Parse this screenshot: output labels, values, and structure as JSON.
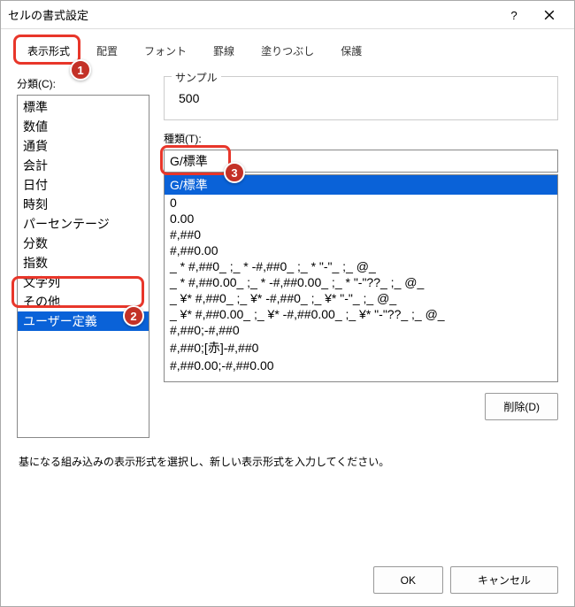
{
  "window": {
    "title": "セルの書式設定"
  },
  "tabs": [
    "表示形式",
    "配置",
    "フォント",
    "罫線",
    "塗りつぶし",
    "保護"
  ],
  "category_label": "分類(C):",
  "categories": [
    "標準",
    "数値",
    "通貨",
    "会計",
    "日付",
    "時刻",
    "パーセンテージ",
    "分数",
    "指数",
    "文字列",
    "その他",
    "ユーザー定義"
  ],
  "selected_category_index": 11,
  "sample": {
    "label": "サンプル",
    "value": "500"
  },
  "type_label": "種類(T):",
  "type_value": "G/標準",
  "type_list": [
    "G/標準",
    "0",
    "0.00",
    "#,##0",
    "#,##0.00",
    "_ * #,##0_ ;_ * -#,##0_ ;_ * \"-\"_ ;_ @_",
    "_ * #,##0.00_ ;_ * -#,##0.00_ ;_ * \"-\"??_ ;_ @_",
    "_ ¥* #,##0_ ;_ ¥* -#,##0_ ;_ ¥* \"-\"_ ;_ @_",
    "_ ¥* #,##0.00_ ;_ ¥* -#,##0.00_ ;_ ¥* \"-\"??_ ;_ @_",
    "#,##0;-#,##0",
    "#,##0;[赤]-#,##0",
    "#,##0.00;-#,##0.00"
  ],
  "selected_type_index": 0,
  "delete_label": "削除(D)",
  "hint": "基になる組み込みの表示形式を選択し、新しい表示形式を入力してください。",
  "footer": {
    "ok": "OK",
    "cancel": "キャンセル"
  },
  "annotations": {
    "n1": "1",
    "n2": "2",
    "n3": "3"
  }
}
